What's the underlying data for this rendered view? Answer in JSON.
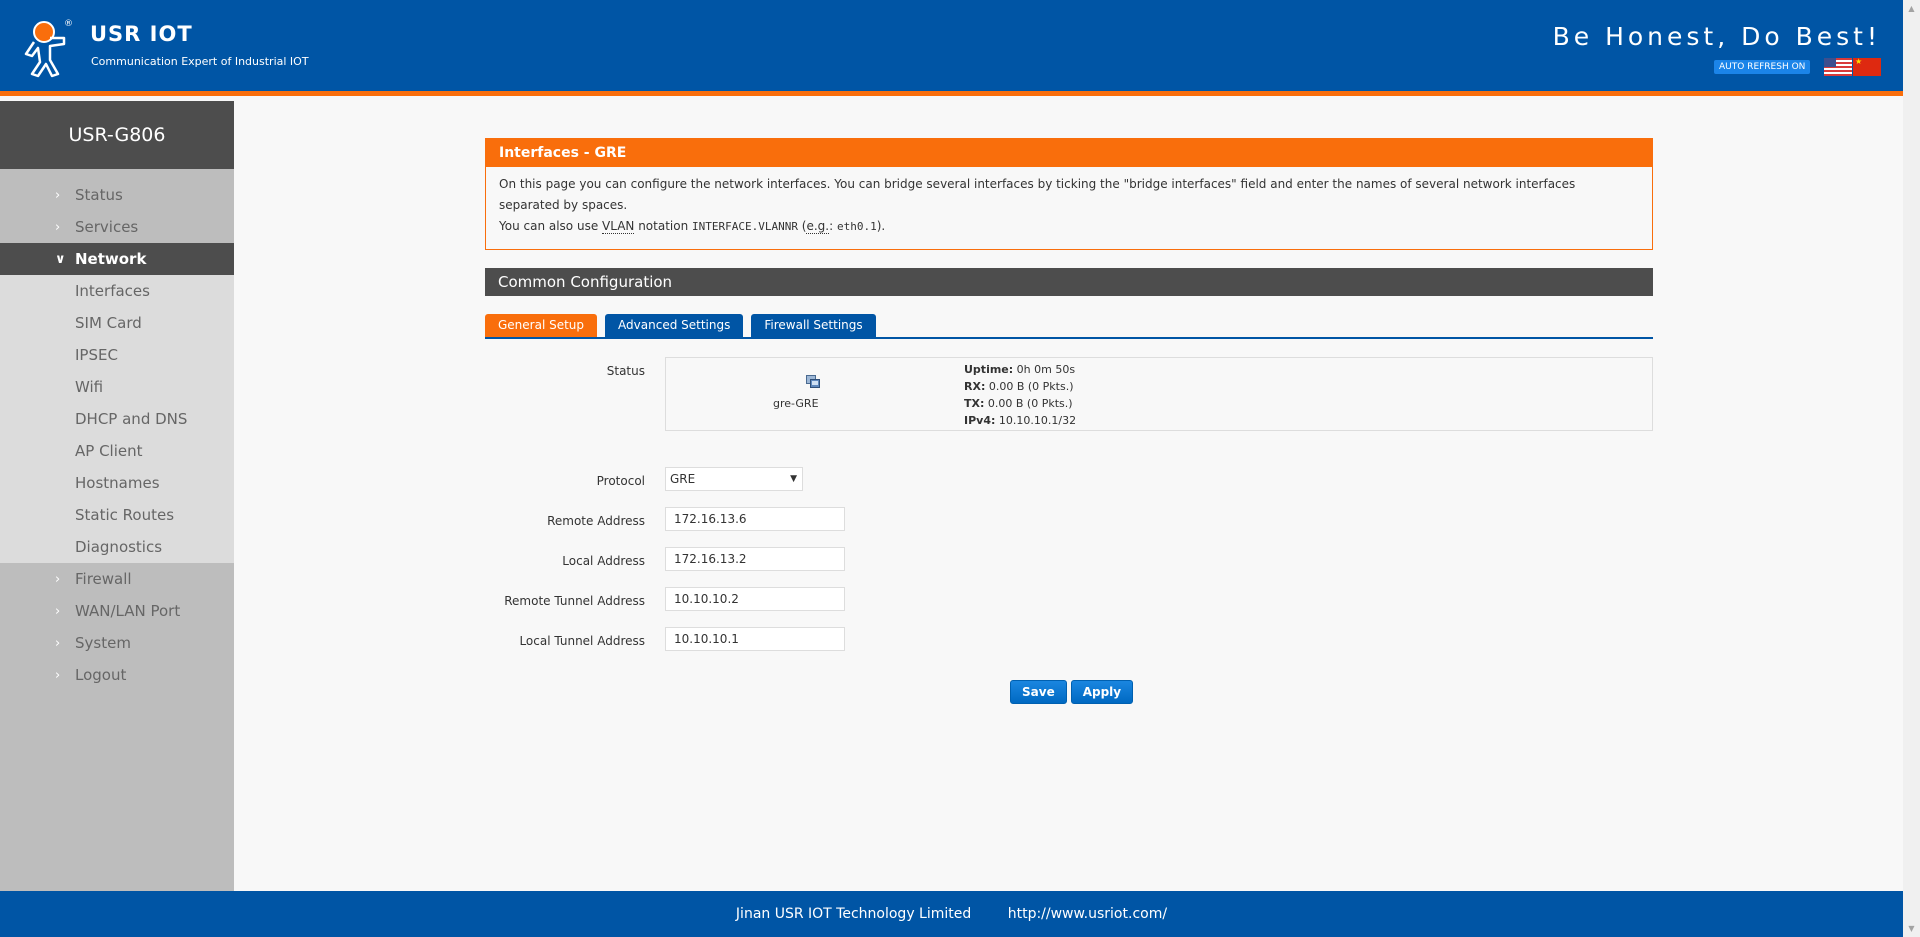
{
  "header": {
    "brand_name": "USR IOT",
    "tagline": "Communication Expert of Industrial IOT",
    "slogan": "Be Honest, Do Best!",
    "auto_refresh_label": "AUTO REFRESH ON",
    "languages": [
      "English",
      "Chinese"
    ]
  },
  "sidebar": {
    "device_name": "USR-G806",
    "items": [
      {
        "label": "Status",
        "expanded": false
      },
      {
        "label": "Services",
        "expanded": false
      },
      {
        "label": "Network",
        "expanded": true
      },
      {
        "label": "Firewall",
        "expanded": false
      },
      {
        "label": "WAN/LAN Port",
        "expanded": false
      },
      {
        "label": "System",
        "expanded": false
      },
      {
        "label": "Logout",
        "expanded": false
      }
    ],
    "network_subitems": [
      "Interfaces",
      "SIM Card",
      "IPSEC",
      "Wifi",
      "DHCP and DNS",
      "AP Client",
      "Hostnames",
      "Static Routes",
      "Diagnostics"
    ]
  },
  "intro": {
    "title": "Interfaces - GRE",
    "line1": "On this page you can configure the network interfaces. You can bridge several interfaces by ticking the \"bridge interfaces\" field and enter the names of several network interfaces separated by spaces.",
    "line2_prefix": "You can also use ",
    "line2_vlan": "VLAN",
    "line2_mid": " notation ",
    "line2_code": "INTERFACE.VLANNR",
    "line2_open": " (",
    "line2_eg": "e.g.",
    "line2_colon": ": ",
    "line2_example": "eth0.1",
    "line2_close": ")."
  },
  "section": {
    "title": "Common Configuration"
  },
  "tabs": [
    {
      "label": "General Setup",
      "active": true
    },
    {
      "label": "Advanced Settings",
      "active": false
    },
    {
      "label": "Firewall Settings",
      "active": false
    }
  ],
  "status": {
    "label": "Status",
    "interface_name": "gre-GRE",
    "uptime_label": "Uptime:",
    "uptime_value": " 0h 0m 50s",
    "rx_label": "RX:",
    "rx_value": " 0.00 B (0 Pkts.)",
    "tx_label": "TX:",
    "tx_value": " 0.00 B (0 Pkts.)",
    "ipv4_label": "IPv4:",
    "ipv4_value": " 10.10.10.1/32"
  },
  "form": {
    "protocol_label": "Protocol",
    "protocol_value": "GRE",
    "remote_address_label": "Remote Address",
    "remote_address_value": "172.16.13.6",
    "local_address_label": "Local Address",
    "local_address_value": "172.16.13.2",
    "remote_tunnel_label": "Remote Tunnel Address",
    "remote_tunnel_value": "10.10.10.2",
    "local_tunnel_label": "Local Tunnel Address",
    "local_tunnel_value": "10.10.10.1"
  },
  "actions": {
    "save_label": "Save",
    "apply_label": "Apply"
  },
  "footer": {
    "company": "Jinan USR IOT Technology Limited",
    "url": "http://www.usriot.com/"
  },
  "colors": {
    "brand_blue": "#0055a5",
    "accent_orange": "#f96e0c",
    "dark_gray": "#4d4d4d"
  }
}
